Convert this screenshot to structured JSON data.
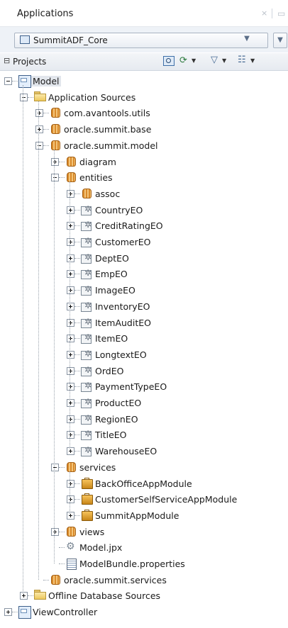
{
  "panel": {
    "title": "Applications",
    "close_glyph": "×",
    "minimize_glyph": "—"
  },
  "project_selector": {
    "value": "SummitADF_Core",
    "icon": "project-icon"
  },
  "projects_section": {
    "label": "Projects",
    "toolbar": [
      "find-icon",
      "sync-icon",
      "filter-icon",
      "layout-icon"
    ]
  },
  "tree": [
    {
      "label": "Model",
      "level": 0,
      "icon": "project",
      "expander": "minus"
    },
    {
      "label": "Application Sources",
      "level": 1,
      "icon": "folder",
      "expander": "minus"
    },
    {
      "label": "com.avantools.utils",
      "level": 2,
      "icon": "package",
      "expander": "plus"
    },
    {
      "label": "oracle.summit.base",
      "level": 2,
      "icon": "package",
      "expander": "plus"
    },
    {
      "label": "oracle.summit.model",
      "level": 2,
      "icon": "package",
      "expander": "minus"
    },
    {
      "label": "diagram",
      "level": 3,
      "icon": "package",
      "expander": "plus"
    },
    {
      "label": "entities",
      "level": 3,
      "icon": "package",
      "expander": "minus"
    },
    {
      "label": "assoc",
      "level": 4,
      "icon": "package",
      "expander": "plus"
    },
    {
      "label": "CountryEO",
      "level": 4,
      "icon": "entity",
      "expander": "plus"
    },
    {
      "label": "CreditRatingEO",
      "level": 4,
      "icon": "entity",
      "expander": "plus"
    },
    {
      "label": "CustomerEO",
      "level": 4,
      "icon": "entity",
      "expander": "plus"
    },
    {
      "label": "DeptEO",
      "level": 4,
      "icon": "entity",
      "expander": "plus"
    },
    {
      "label": "EmpEO",
      "level": 4,
      "icon": "entity",
      "expander": "plus"
    },
    {
      "label": "ImageEO",
      "level": 4,
      "icon": "entity",
      "expander": "plus"
    },
    {
      "label": "InventoryEO",
      "level": 4,
      "icon": "entity",
      "expander": "plus"
    },
    {
      "label": "ItemAuditEO",
      "level": 4,
      "icon": "entity",
      "expander": "plus"
    },
    {
      "label": "ItemEO",
      "level": 4,
      "icon": "entity",
      "expander": "plus"
    },
    {
      "label": "LongtextEO",
      "level": 4,
      "icon": "entity",
      "expander": "plus"
    },
    {
      "label": "OrdEO",
      "level": 4,
      "icon": "entity",
      "expander": "plus"
    },
    {
      "label": "PaymentTypeEO",
      "level": 4,
      "icon": "entity",
      "expander": "plus"
    },
    {
      "label": "ProductEO",
      "level": 4,
      "icon": "entity",
      "expander": "plus"
    },
    {
      "label": "RegionEO",
      "level": 4,
      "icon": "entity",
      "expander": "plus"
    },
    {
      "label": "TitleEO",
      "level": 4,
      "icon": "entity",
      "expander": "plus"
    },
    {
      "label": "WarehouseEO",
      "level": 4,
      "icon": "entity",
      "expander": "plus"
    },
    {
      "label": "services",
      "level": 3,
      "icon": "package",
      "expander": "minus"
    },
    {
      "label": "BackOfficeAppModule",
      "level": 4,
      "icon": "appmod",
      "expander": "plus"
    },
    {
      "label": "CustomerSelfServiceAppModule",
      "level": 4,
      "icon": "appmod",
      "expander": "plus"
    },
    {
      "label": "SummitAppModule",
      "level": 4,
      "icon": "appmod",
      "expander": "plus"
    },
    {
      "label": "views",
      "level": 3,
      "icon": "package",
      "expander": "plus"
    },
    {
      "label": "Model.jpx",
      "level": 3,
      "icon": "jpx",
      "expander": "none"
    },
    {
      "label": "ModelBundle.properties",
      "level": 3,
      "icon": "props",
      "expander": "none"
    },
    {
      "label": "oracle.summit.services",
      "level": 2,
      "icon": "package",
      "expander": "none"
    },
    {
      "label": "Offline Database Sources",
      "level": 1,
      "icon": "folder",
      "expander": "plus"
    },
    {
      "label": "ViewController",
      "level": 0,
      "icon": "project",
      "expander": "plus"
    }
  ]
}
